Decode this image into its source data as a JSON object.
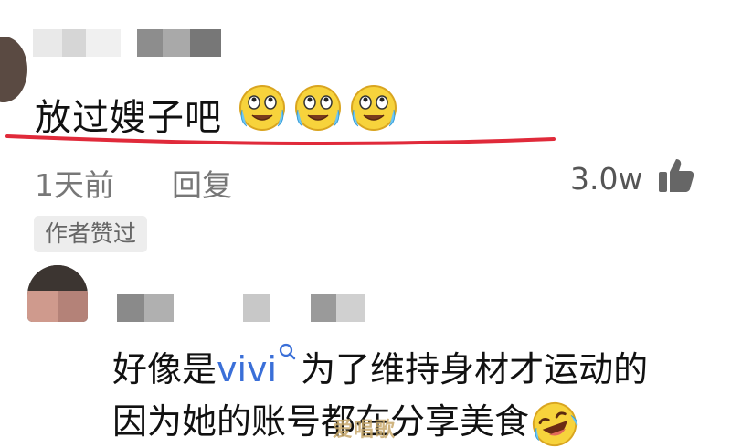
{
  "first_comment": {
    "text": "放过嫂子吧",
    "emoji_icon": "laugh-cry-emoji",
    "time": "1天前",
    "reply_label": "回复",
    "like_count": "3.0w",
    "author_badge": "作者赞过"
  },
  "second_comment": {
    "line1_prefix": "好像是",
    "mention": "vivi",
    "line1_suffix": "为了维持身材才运动的",
    "line2": "因为她的账号都在分享美食",
    "emoji_icon": "laughing-tears-emoji"
  },
  "watermark": "爱唱歌",
  "colors": {
    "underline": "#e02a3a",
    "mention": "#3a6fd8",
    "meta": "#777777",
    "badge_bg": "#ededed"
  }
}
